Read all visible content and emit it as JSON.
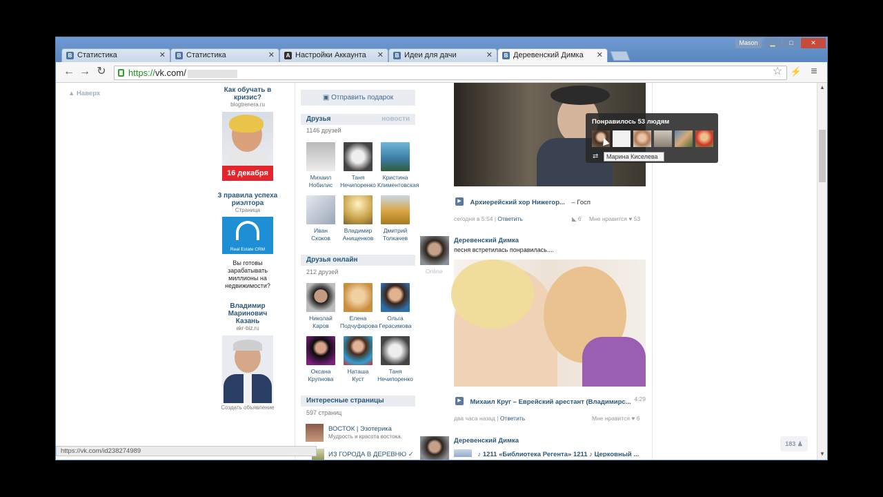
{
  "browser": {
    "user": "Mason",
    "tabs": [
      {
        "label": "Статистика",
        "icon": "vk-icon"
      },
      {
        "label": "Статистика",
        "icon": "vk-icon"
      },
      {
        "label": "Настройки Аккаунта",
        "icon": "a-icon"
      },
      {
        "label": "Идеи для дачи",
        "icon": "vk-icon"
      },
      {
        "label": "Деревенский Димка",
        "icon": "vk-icon"
      }
    ],
    "url_scheme": "https://",
    "url_host": "vk.com/",
    "status_url": "https://vk.com/id238274989"
  },
  "page": {
    "up_link": "Наверх",
    "ads": [
      {
        "title": "Как обучать в кризис?",
        "domain": "blogtrenera.ru",
        "badge": "16 декабря"
      },
      {
        "title": "3 правила успеха риэлтора",
        "domain": "Страница",
        "caption": "Real Estate CRM",
        "text": "Вы готовы зарабатывать миллионы на недвижимости?"
      },
      {
        "title": "Владимир Маринович Казань",
        "domain": "akr-biz.ru"
      }
    ],
    "create_ad": "Создать объявление",
    "gift_button": "Отправить подарок",
    "friends": {
      "title": "Друзья",
      "news_link": "новости",
      "count": "1146 друзей",
      "items": [
        {
          "first": "Михаил",
          "last": "Нобилис"
        },
        {
          "first": "Таня",
          "last": "Нечипоренко"
        },
        {
          "first": "Кристина",
          "last": "Климентовская"
        },
        {
          "first": "Иван",
          "last": "Скоков"
        },
        {
          "first": "Владимир",
          "last": "Анищенков"
        },
        {
          "first": "Дмитрий",
          "last": "Толкачев"
        }
      ]
    },
    "friends_online": {
      "title": "Друзья онлайн",
      "count": "212 друзей",
      "items": [
        {
          "first": "Николай",
          "last": "Каров"
        },
        {
          "first": "Елена",
          "last": "Подчуфарова"
        },
        {
          "first": "Ольга",
          "last": "Герасимова"
        },
        {
          "first": "Оксана",
          "last": "Крупнова"
        },
        {
          "first": "Наташа",
          "last": "Куст"
        },
        {
          "first": "Таня",
          "last": "Нечипоренко"
        }
      ]
    },
    "pages": {
      "title": "Интересные страницы",
      "count": "597 страниц",
      "items": [
        {
          "name": "ВОСТОК | Эзотерика",
          "desc": "Мудрость и красота востока."
        },
        {
          "name": "ИЗ ГОРОДА В ДЕРЕВНЮ ✓",
          "desc": ""
        }
      ]
    },
    "feed": {
      "post1": {
        "audio": "Архиерейский хор Нижегор...",
        "audio_extra": "– Госп",
        "time": "сегодня в 5:54",
        "reply": "Ответить",
        "reposts": "6",
        "like_label": "Мне нравится",
        "likes": "53"
      },
      "post2": {
        "author": "Деревенский Димка",
        "online": "Online",
        "text": "песня встретилась понравилась....",
        "audio": "Михаил Круг – Еврейский арестант (Владимирс...",
        "duration": "4:29",
        "time": "два часа назад",
        "reply": "Ответить",
        "like_label": "Мне нравится",
        "likes": "6"
      },
      "post3": {
        "author": "Деревенский Димка",
        "text": "♪ 1211 «Библиотека Регента» 1211 ♪ Церковный ..."
      }
    },
    "likes_tooltip": {
      "title": "Понравилось 53 людям",
      "hover_name": "Марина Киселева"
    },
    "online_counter": "183"
  }
}
